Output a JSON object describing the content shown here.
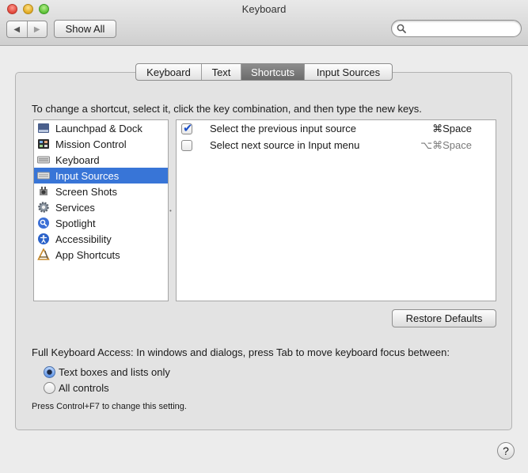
{
  "window": {
    "title": "Keyboard"
  },
  "toolbar": {
    "back_glyph": "◀",
    "forward_glyph": "▶",
    "show_all_label": "Show All",
    "search": {
      "value": "",
      "placeholder": ""
    }
  },
  "tabs": [
    {
      "label": "Keyboard",
      "selected": false
    },
    {
      "label": "Text",
      "selected": false
    },
    {
      "label": "Shortcuts",
      "selected": true
    },
    {
      "label": "Input Sources",
      "selected": false
    }
  ],
  "instruction": "To change a shortcut, select it, click the key combination, and then type the new keys.",
  "categories": [
    {
      "label": "Launchpad & Dock",
      "icon": "launchpad-dock-icon",
      "selected": false
    },
    {
      "label": "Mission Control",
      "icon": "mission-control-icon",
      "selected": false
    },
    {
      "label": "Keyboard",
      "icon": "keyboard-icon",
      "selected": false
    },
    {
      "label": "Input Sources",
      "icon": "input-sources-icon",
      "selected": true
    },
    {
      "label": "Screen Shots",
      "icon": "screen-shots-icon",
      "selected": false
    },
    {
      "label": "Services",
      "icon": "gear-icon",
      "selected": false
    },
    {
      "label": "Spotlight",
      "icon": "spotlight-icon",
      "selected": false
    },
    {
      "label": "Accessibility",
      "icon": "accessibility-icon",
      "selected": false
    },
    {
      "label": "App Shortcuts",
      "icon": "app-shortcuts-icon",
      "selected": false
    }
  ],
  "shortcuts": [
    {
      "label": "Select the previous input source",
      "keys": "⌘Space",
      "checked": true,
      "dim": false
    },
    {
      "label": "Select next source in Input menu",
      "keys": "⌥⌘Space",
      "checked": false,
      "dim": true
    }
  ],
  "restore_defaults_label": "Restore Defaults",
  "full_keyboard_access": {
    "text": "Full Keyboard Access: In windows and dialogs, press Tab to move keyboard focus between:",
    "options": [
      {
        "label": "Text boxes and lists only",
        "selected": true
      },
      {
        "label": "All controls",
        "selected": false
      }
    ],
    "hint": "Press Control+F7 to change this setting."
  },
  "help_label": "?",
  "colors": {
    "selection": "#3875d7",
    "checkmark": "#1c4fc6"
  }
}
